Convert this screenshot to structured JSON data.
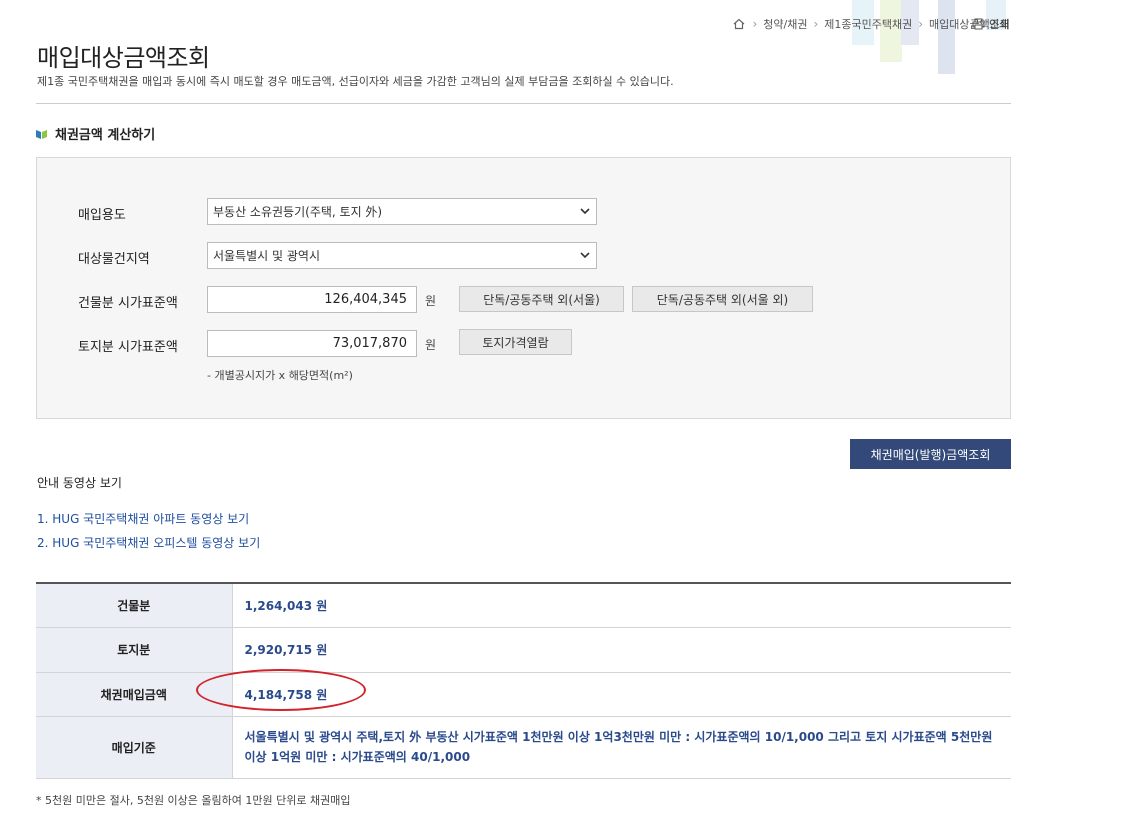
{
  "breadcrumb": {
    "items": [
      "청약/채권",
      "제1종국민주택채권",
      "매입대상금액조회"
    ],
    "print_label": "인쇄"
  },
  "page": {
    "title": "매입대상금액조회",
    "description": "제1종 국민주택채권을 매입과 동시에 즉시 매도할 경우 매도금액, 선급이자와 세금을 가감한 고객님의 실제 부담금을 조회하실 수 있습니다."
  },
  "calc": {
    "section_title": "채권금액 계산하기",
    "purpose_label": "매입용도",
    "purpose_value": "부동산 소유권등기(주택, 토지 外)",
    "region_label": "대상물건지역",
    "region_value": "서울특별시 및 광역시",
    "building_label": "건물분 시가표준액",
    "building_value": "126,404,345",
    "building_unit": "원",
    "btn_detached_seoul": "단독/공동주택 외(서울)",
    "btn_detached_outside": "단독/공동주택 외(서울 외)",
    "land_label": "토지분 시가표준액",
    "land_value": "73,017,870",
    "land_unit": "원",
    "btn_land_price": "토지가격열람",
    "land_note": "- 개별공시지가 x 해당면적(m²)",
    "submit_label": "채권매입(발행)금액조회"
  },
  "videos": {
    "heading": "안내 동영상 보기",
    "links": [
      "1. HUG 국민주택채권 아파트 동영상 보기",
      "2. HUG 국민주택채권 오피스텔 동영상 보기"
    ]
  },
  "result": {
    "rows": [
      {
        "label": "건물분",
        "value": "1,264,043 원"
      },
      {
        "label": "토지분",
        "value": "2,920,715 원"
      },
      {
        "label": "채권매입금액",
        "value": "4,184,758 원"
      },
      {
        "label": "매입기준",
        "value": "서울특별시 및 광역시 주택,토지 外 부동산 시가표준액 1천만원 이상 1억3천만원 미만 : 시가표준액의 10/1,000 그리고 토지 시가표준액 5천만원 이상 1억원 미만 : 시가표준액의 40/1,000"
      }
    ],
    "highlight_color": "#d1232a"
  },
  "footnote": "* 5천원 미만은 절사, 5천원 이상은 올림하여 1만원 단위로 채권매입"
}
